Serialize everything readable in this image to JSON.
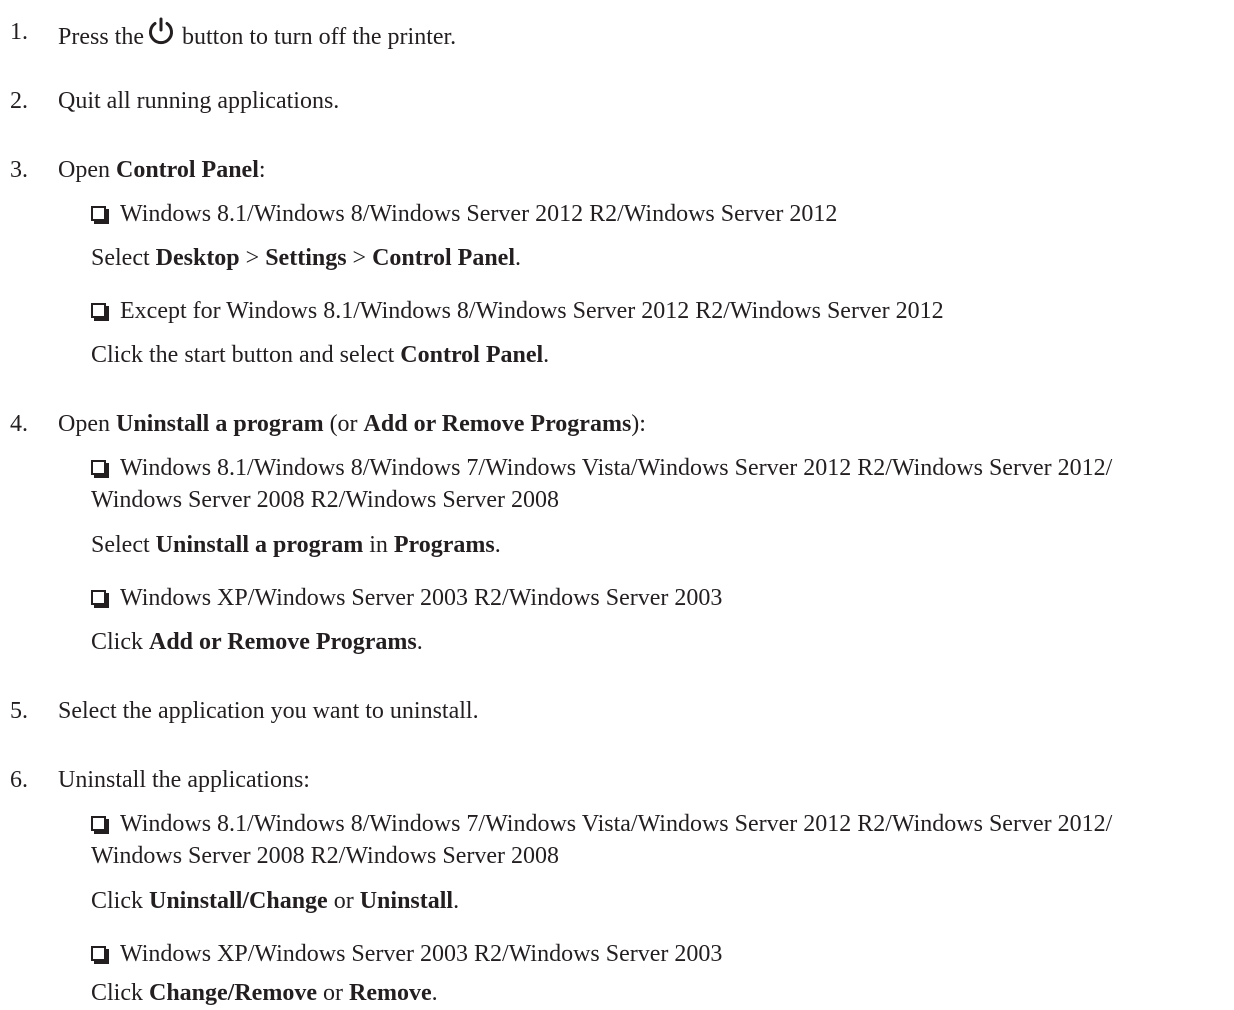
{
  "steps": [
    {
      "num": "1.",
      "pre": "Press the",
      "icon": "power-icon",
      "post": "button to turn off the printer."
    },
    {
      "num": "2.",
      "text": "Quit all running applications."
    },
    {
      "num": "3.",
      "pre": "Open ",
      "b1": "Control Panel",
      "post": ":"
    },
    {
      "num": "4.",
      "pre": "Open ",
      "b1": "Uninstall a program",
      "mid": " (or ",
      "b2": "Add or Remove Programs",
      "post": "):"
    },
    {
      "num": "5.",
      "text": "Select the application you want to uninstall."
    },
    {
      "num": "6.",
      "text": "Uninstall the applications:"
    }
  ],
  "s3": {
    "a_text": "Windows 8.1/Windows 8/Windows Server 2012 R2/Windows Server 2012",
    "a_instr": {
      "pre": "Select ",
      "b1": "Desktop",
      "s1": " > ",
      "b2": "Settings",
      "s2": " > ",
      "b3": "Control Panel",
      "post": "."
    },
    "b_text": "Except for Windows 8.1/Windows 8/Windows Server 2012 R2/Windows Server 2012",
    "b_instr": {
      "pre": "Click the start button and select ",
      "b1": "Control Panel",
      "post": "."
    }
  },
  "s4": {
    "a_line1": "Windows 8.1/Windows 8/Windows 7/Windows Vista/Windows Server 2012 R2/Windows Server 2012/",
    "a_line2": "Windows Server 2008 R2/Windows Server 2008",
    "a_instr": {
      "pre": "Select ",
      "b1": "Uninstall a program",
      "mid": " in ",
      "b2": "Programs",
      "post": "."
    },
    "b_text": "Windows XP/Windows Server 2003 R2/Windows Server 2003",
    "b_instr": {
      "pre": "Click ",
      "b1": "Add or Remove Programs",
      "post": "."
    }
  },
  "s6": {
    "a_line1": "Windows 8.1/Windows 8/Windows 7/Windows Vista/Windows Server 2012 R2/Windows Server 2012/",
    "a_line2": "Windows Server 2008 R2/Windows Server 2008",
    "a_instr": {
      "pre": "Click ",
      "b1": "Uninstall/Change",
      "mid": " or ",
      "b2": "Uninstall",
      "post": "."
    },
    "b_text": "Windows XP/Windows Server 2003 R2/Windows Server 2003",
    "b_instr": {
      "pre": "Click ",
      "b1": "Change/Remove",
      "mid": " or ",
      "b2": "Remove",
      "post": "."
    }
  }
}
